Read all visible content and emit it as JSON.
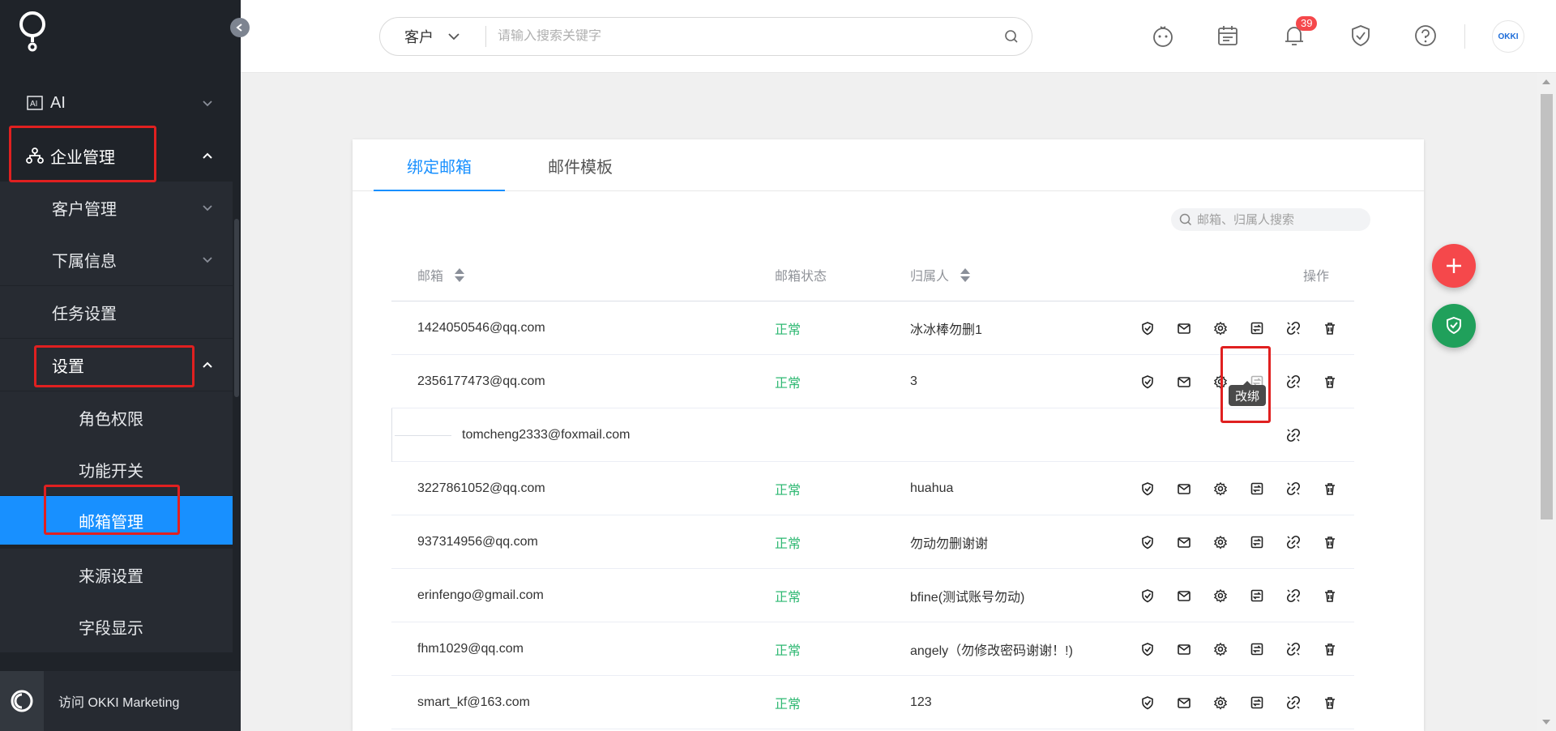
{
  "colors": {
    "sidebar_bg": "#1f2329",
    "accent": "#1890ff",
    "status_ok": "#2eb872",
    "badge": "#f5484b",
    "fab_add": "#f5484b",
    "fab_shield": "#20a05b"
  },
  "sidebar": {
    "items": [
      {
        "label": "AI",
        "icon": "ai-icon"
      },
      {
        "label": "企业管理",
        "icon": "org-tree-icon"
      },
      {
        "label": "客户管理"
      },
      {
        "label": "下属信息"
      },
      {
        "label": "任务设置"
      },
      {
        "label": "设置"
      },
      {
        "label": "角色权限"
      },
      {
        "label": "功能开关"
      },
      {
        "label": "邮箱管理"
      },
      {
        "label": "来源设置"
      },
      {
        "label": "字段显示"
      }
    ],
    "footer": "访问 OKKI Marketing"
  },
  "header": {
    "search_type": "客户",
    "search_placeholder": "请输入搜索关键字",
    "notification_count": "39",
    "avatar_text": "OKKI"
  },
  "tabs": [
    "绑定邮箱",
    "邮件模板"
  ],
  "table": {
    "search_placeholder": "邮箱、归属人搜索",
    "headers": {
      "email": "邮箱",
      "status": "邮箱状态",
      "owner": "归属人",
      "ops": "操作"
    },
    "rows": [
      {
        "email": "1424050546@qq.com",
        "status": "正常",
        "owner": "冰冰棒勿删1"
      },
      {
        "email": "2356177473@qq.com",
        "status": "正常",
        "owner": "3"
      },
      {
        "email": "tomcheng2333@foxmail.com",
        "child": true
      },
      {
        "email": "3227861052@qq.com",
        "status": "正常",
        "owner": "huahua"
      },
      {
        "email": "937314956@qq.com",
        "status": "正常",
        "owner": "勿动勿删谢谢"
      },
      {
        "email": "erinfengo@gmail.com",
        "status": "正常",
        "owner": "bfine(测试账号勿动)"
      },
      {
        "email": "fhm1029@qq.com",
        "status": "正常",
        "owner": "angely（勿修改密码谢谢！!)"
      },
      {
        "email": "smart_kf@163.com",
        "status": "正常",
        "owner": "123"
      }
    ],
    "tooltip": "改绑"
  }
}
